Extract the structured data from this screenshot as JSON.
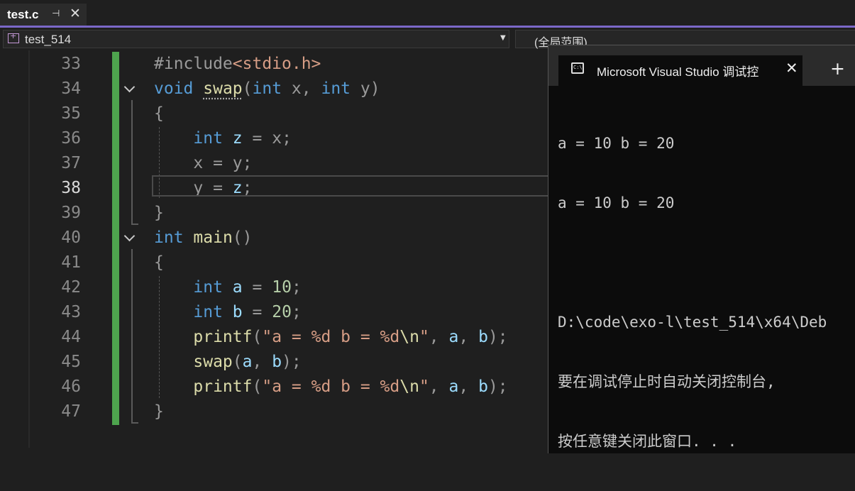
{
  "tab": {
    "filename": "test.c",
    "pin_glyph": "⊣",
    "close_glyph": "✕"
  },
  "navbar": {
    "project": "test_514",
    "scope": "(全局范围)"
  },
  "editor": {
    "line_numbers": [
      "33",
      "34",
      "35",
      "36",
      "37",
      "38",
      "39",
      "40",
      "41",
      "42",
      "43",
      "44",
      "45",
      "46",
      "47"
    ],
    "current_line": "38"
  },
  "console": {
    "title": "Microsoft Visual Studio 调试控",
    "close_glyph": "✕",
    "new_tab_glyph": "+",
    "lines": [
      "a = 10 b = 20",
      "a = 10 b = 20",
      "",
      "D:\\code\\exo-l\\test_514\\x64\\Deb",
      "要在调试停止时自动关闭控制台,",
      "按任意键关闭此窗口. . ."
    ]
  },
  "colors": {
    "accent": "#7b68c8",
    "change_bar": "#4ea44e",
    "keyword": "#569cd6",
    "function": "#dcdcaa",
    "string": "#d69d85",
    "number": "#b5cea8"
  }
}
